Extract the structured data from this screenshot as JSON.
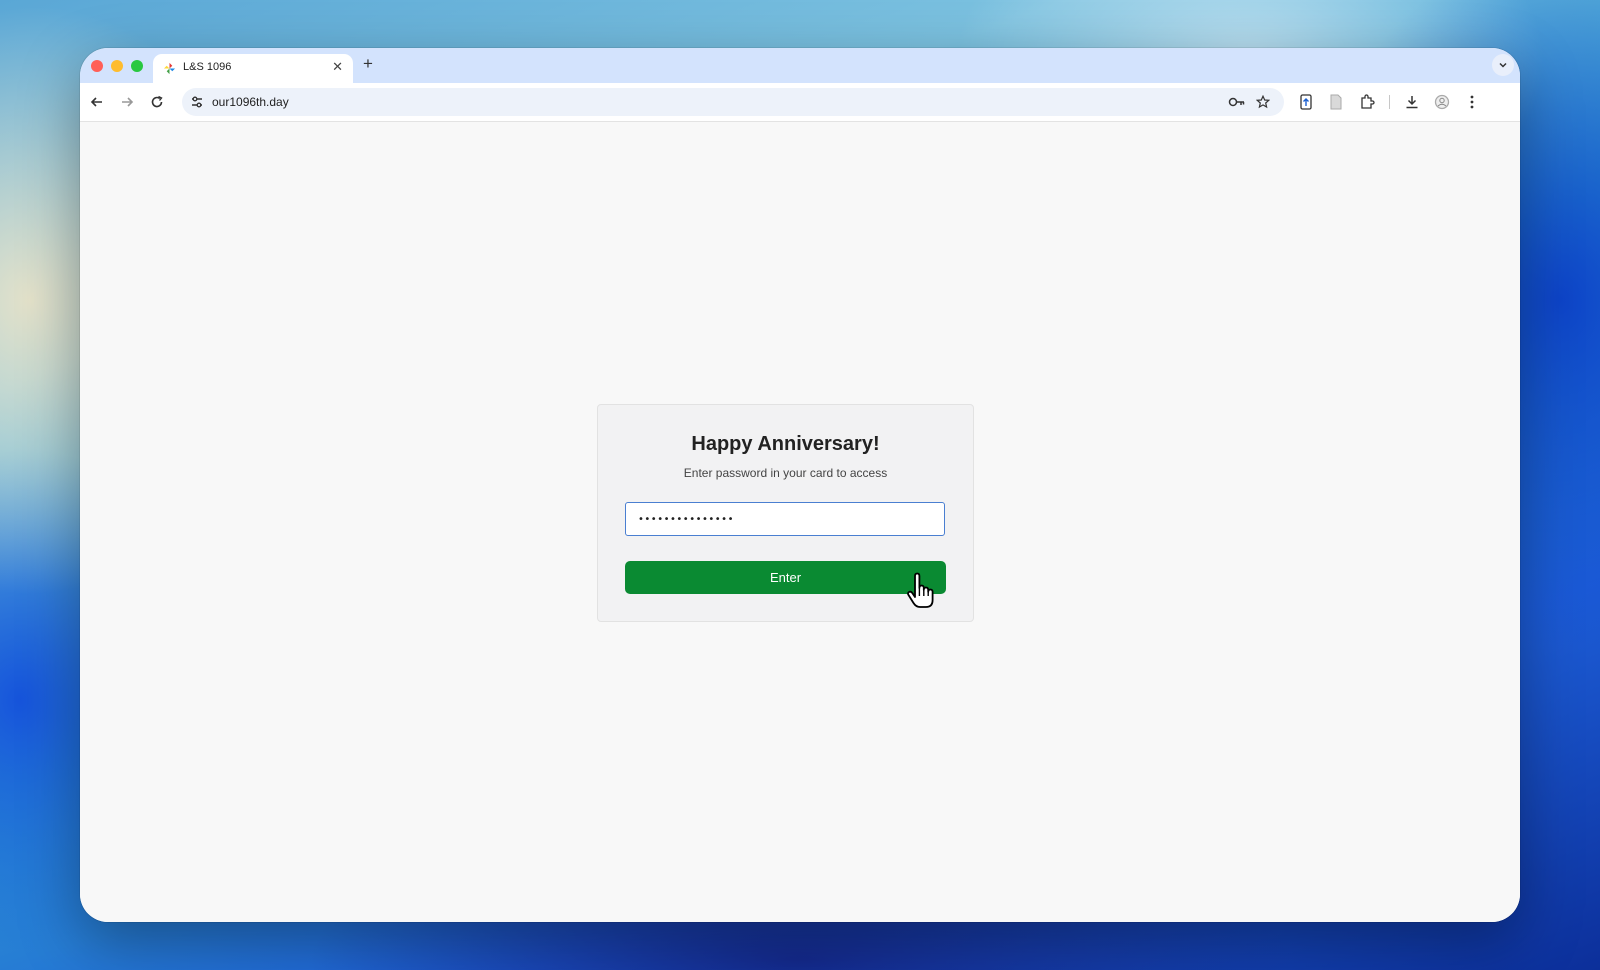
{
  "browser": {
    "tab": {
      "title": "L&S 1096",
      "close_glyph": "✕",
      "favicon": "pinwheel-favicon-icon"
    },
    "new_tab_glyph": "+",
    "address_bar": {
      "url": "our1096th.day"
    },
    "toolbar_icons": [
      "back-icon",
      "forward-icon",
      "reload-icon",
      "site-settings-icon",
      "password-key-icon",
      "bookmark-star-icon",
      "extension-upload-icon",
      "reader-document-icon",
      "extensions-puzzle-icon",
      "download-icon",
      "profile-icon",
      "menu-more-icon"
    ]
  },
  "page": {
    "title": "Happy Anniversary!",
    "subtitle": "Enter password in your card to access",
    "password_value": "•••••••••••••••",
    "enter_button_label": "Enter"
  },
  "colors": {
    "tabstrip": "#d3e3fd",
    "button": "#0a8a32",
    "input_border": "#4a7fd1",
    "page_background": "#f8f8f8"
  }
}
